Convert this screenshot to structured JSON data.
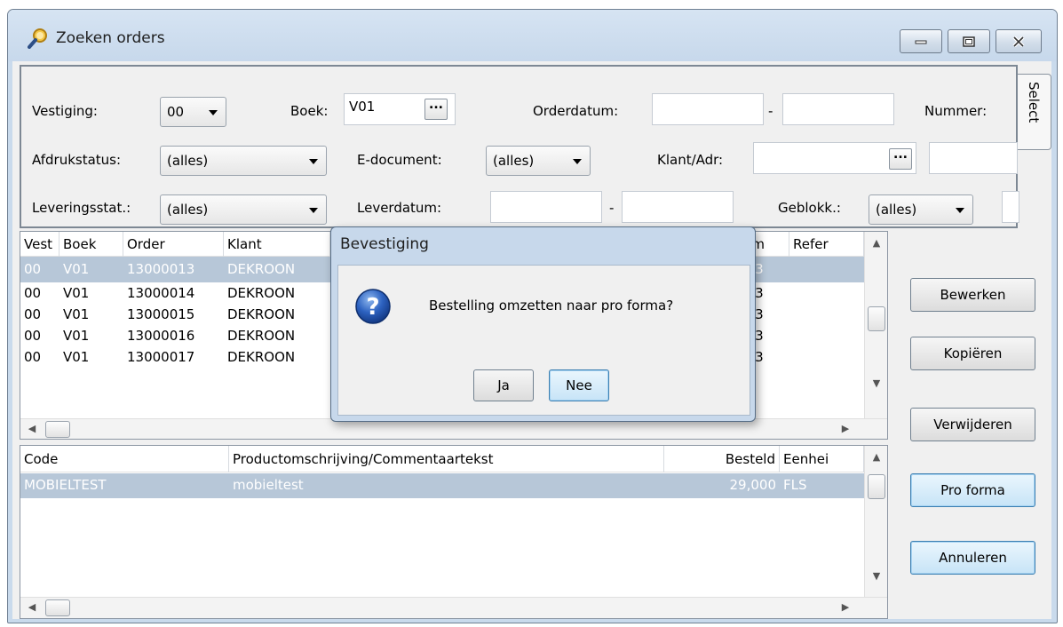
{
  "window": {
    "title": "Zoeken orders",
    "minimize_icon": "minimize-icon",
    "maximize_icon": "maximize-icon",
    "close_icon": "close-icon"
  },
  "filters": {
    "vestiging_label": "Vestiging:",
    "vestiging_value": "00",
    "boek_label": "Boek:",
    "boek_value": "V01",
    "ellipsis": "...",
    "orderdatum_label": "Orderdatum:",
    "orderdatum_from": "",
    "orderdatum_to": "",
    "range_sep": "-",
    "nummer_label": "Nummer:",
    "afdrukstatus_label": "Afdrukstatus:",
    "afdrukstatus_value": "(alles)",
    "edocument_label": "E-document:",
    "edocument_value": "(alles)",
    "klant_label": "Klant/Adr:",
    "klant_value": "",
    "leveringsstat_label": "Leveringsstat.:",
    "leveringsstat_value": "(alles)",
    "leverdatum_label": "Leverdatum:",
    "leverdatum_from": "",
    "leverdatum_to": "",
    "geblokk_label": "Geblokk.:",
    "geblokk_value": "(alles)",
    "select_tab": "Select"
  },
  "orders": {
    "columns": [
      "Vest",
      "Boek",
      "Order",
      "Klant",
      "tum",
      "Refer"
    ],
    "rows": [
      {
        "vest": "00",
        "boek": "V01",
        "order": "13000013",
        "klant": "DEKROON",
        "tum": "013",
        "selected": true
      },
      {
        "vest": "00",
        "boek": "V01",
        "order": "13000014",
        "klant": "DEKROON",
        "tum": "013",
        "selected": false
      },
      {
        "vest": "00",
        "boek": "V01",
        "order": "13000015",
        "klant": "DEKROON",
        "tum": "013",
        "selected": false
      },
      {
        "vest": "00",
        "boek": "V01",
        "order": "13000016",
        "klant": "DEKROON",
        "tum": "013",
        "selected": false
      },
      {
        "vest": "00",
        "boek": "V01",
        "order": "13000017",
        "klant": "DEKROON",
        "tum": "013",
        "selected": false
      }
    ]
  },
  "lines": {
    "columns": [
      "Code",
      "Productomschrijving/Commentaartekst",
      "Besteld",
      "Eenhei"
    ],
    "rows": [
      {
        "code": "MOBIELTEST",
        "omschrijving": "mobieltest",
        "besteld": "29,000",
        "eenheid": "FLS",
        "selected": true
      }
    ]
  },
  "actions": {
    "bewerken": "Bewerken",
    "kopieren": "Kopiëren",
    "verwijderen": "Verwijderen",
    "proforma": "Pro forma",
    "annuleren": "Annuleren"
  },
  "dialog": {
    "title": "Bevestiging",
    "message": "Bestelling omzetten naar pro forma?",
    "icon": "question-icon",
    "yes": "Ja",
    "no": "Nee"
  },
  "colors": {
    "titlebar": "#c9daec",
    "selection": "#b7c7d8",
    "focus_button": "#c7e4f7"
  }
}
